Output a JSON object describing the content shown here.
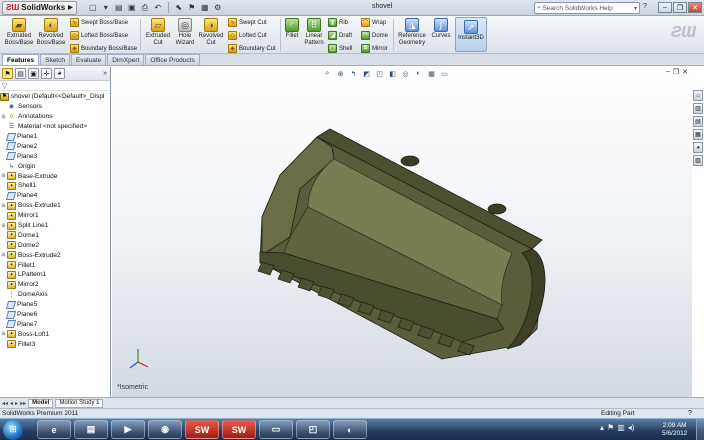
{
  "app": {
    "logo_text": "SolidWorks",
    "document_title": "shovel",
    "search_placeholder": "Search SolidWorks Help"
  },
  "ribbon": {
    "extruded_boss": "Extruded Boss/Base",
    "revolved_boss": "Revolved Boss/Base",
    "swept_boss": "Swept Boss/Base",
    "lofted_boss": "Lofted Boss/Base",
    "boundary_boss": "Boundary Boss/Base",
    "extruded_cut": "Extruded Cut",
    "hole_wizard": "Hole Wizard",
    "revolved_cut": "Revolved Cut",
    "swept_cut": "Swept Cut",
    "lofted_cut": "Lofted Cut",
    "boundary_cut": "Boundary Cut",
    "fillet": "Fillet",
    "linear_pattern": "Linear Pattern",
    "rib": "Rib",
    "draft": "Draft",
    "shell": "Shell",
    "wrap": "Wrap",
    "dome": "Dome",
    "mirror": "Mirror",
    "reference_geometry": "Reference Geometry",
    "curves": "Curves",
    "instant3d": "Instant3D"
  },
  "tabs": [
    "Features",
    "Sketch",
    "Evaluate",
    "DimXpert",
    "Office Products"
  ],
  "tree": {
    "root": "shovel  (Default<<Default>_Displ",
    "items": [
      {
        "label": "Sensors",
        "icon": "sensor-icon"
      },
      {
        "label": "Annotations",
        "icon": "annotation-icon",
        "expandable": true
      },
      {
        "label": "Material <not specified>",
        "icon": "material-icon"
      },
      {
        "label": "Plane1",
        "icon": "plane-icon"
      },
      {
        "label": "Plane2",
        "icon": "plane-icon"
      },
      {
        "label": "Plane3",
        "icon": "plane-icon"
      },
      {
        "label": "Origin",
        "icon": "origin-icon"
      },
      {
        "label": "Base-Extrude",
        "icon": "feature-icon",
        "expandable": true
      },
      {
        "label": "Shell1",
        "icon": "feature-icon"
      },
      {
        "label": "Plane4",
        "icon": "plane-icon"
      },
      {
        "label": "Boss-Extrude1",
        "icon": "feature-icon",
        "expandable": true
      },
      {
        "label": "Mirror1",
        "icon": "feature-icon"
      },
      {
        "label": "Split Line1",
        "icon": "feature-icon",
        "expandable": true
      },
      {
        "label": "Dome1",
        "icon": "feature-icon"
      },
      {
        "label": "Dome2",
        "icon": "feature-icon"
      },
      {
        "label": "Boss-Extrude2",
        "icon": "feature-icon",
        "expandable": true
      },
      {
        "label": "Fillet1",
        "icon": "feature-icon"
      },
      {
        "label": "LPattern1",
        "icon": "feature-icon"
      },
      {
        "label": "Mirror2",
        "icon": "feature-icon"
      },
      {
        "label": "DomeAxis",
        "icon": "axis-icon"
      },
      {
        "label": "Plane5",
        "icon": "plane-icon"
      },
      {
        "label": "Plane6",
        "icon": "plane-icon"
      },
      {
        "label": "Plane7",
        "icon": "plane-icon"
      },
      {
        "label": "Boss-Loft1",
        "icon": "feature-icon",
        "expandable": true
      },
      {
        "label": "Fillet3",
        "icon": "feature-icon"
      }
    ]
  },
  "viewport": {
    "orientation_label": "*Isometric"
  },
  "bottom_tabs": [
    "Model",
    "Motion Study 1"
  ],
  "status": {
    "left": "SolidWorks Premium 2011",
    "right": "Editing Part",
    "help": "?"
  },
  "taskbar": {
    "time": "2:09 AM",
    "date": "5/6/2012"
  },
  "colors": {
    "model_body": "#5a5c3b",
    "model_inner": "#6e7048",
    "model_edge": "#1e1f12",
    "accent": "#c8102e"
  }
}
